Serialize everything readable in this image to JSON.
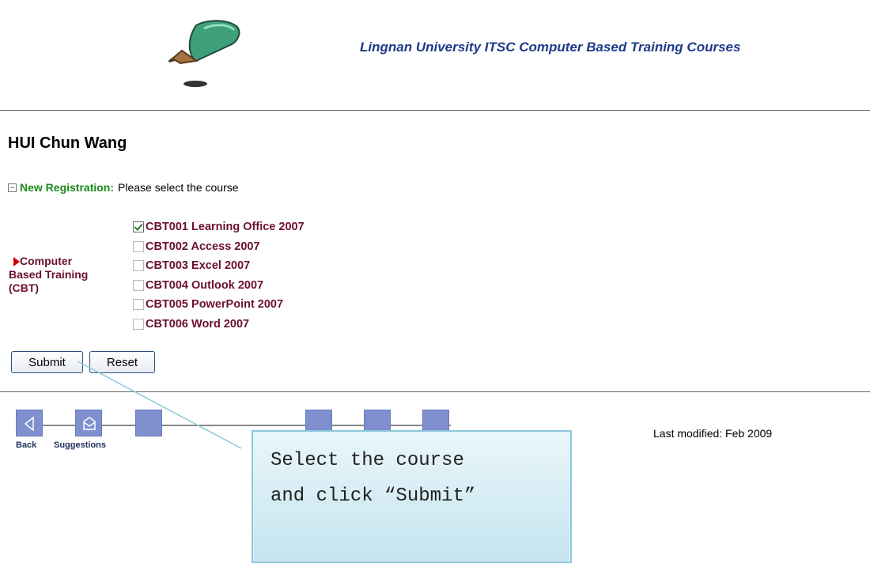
{
  "header": {
    "site_title": "Lingnan University ITSC Computer Based Training Courses",
    "logo_icon": "pencil-logo-icon"
  },
  "user": {
    "name": "HUI Chun Wang"
  },
  "registration": {
    "label": "New Registration:",
    "instruction": "Please select the course"
  },
  "category": {
    "line1": "Computer",
    "line2": "Based Training",
    "line3": "(CBT)"
  },
  "courses": [
    {
      "label": "CBT001 Learning Office 2007",
      "checked": true
    },
    {
      "label": "CBT002 Access 2007",
      "checked": false
    },
    {
      "label": "CBT003 Excel 2007",
      "checked": false
    },
    {
      "label": "CBT004 Outlook 2007",
      "checked": false
    },
    {
      "label": "CBT005 PowerPoint 2007",
      "checked": false
    },
    {
      "label": "CBT006 Word 2007",
      "checked": false
    }
  ],
  "buttons": {
    "submit": "Submit",
    "reset": "Reset"
  },
  "nav": {
    "back_label": "Back",
    "suggestions_label": "Suggestions"
  },
  "footer": {
    "last_modified": "Last modified: Feb 2009"
  },
  "callout": {
    "line1": "Select the course",
    "line2": "and click “Submit”"
  },
  "colors": {
    "title_blue": "#1f3a8a",
    "course_maroon": "#6b1030",
    "registration_green": "#1a8a1a",
    "nav_square": "#7f8fcf",
    "callout_border": "#8ec8dc"
  }
}
